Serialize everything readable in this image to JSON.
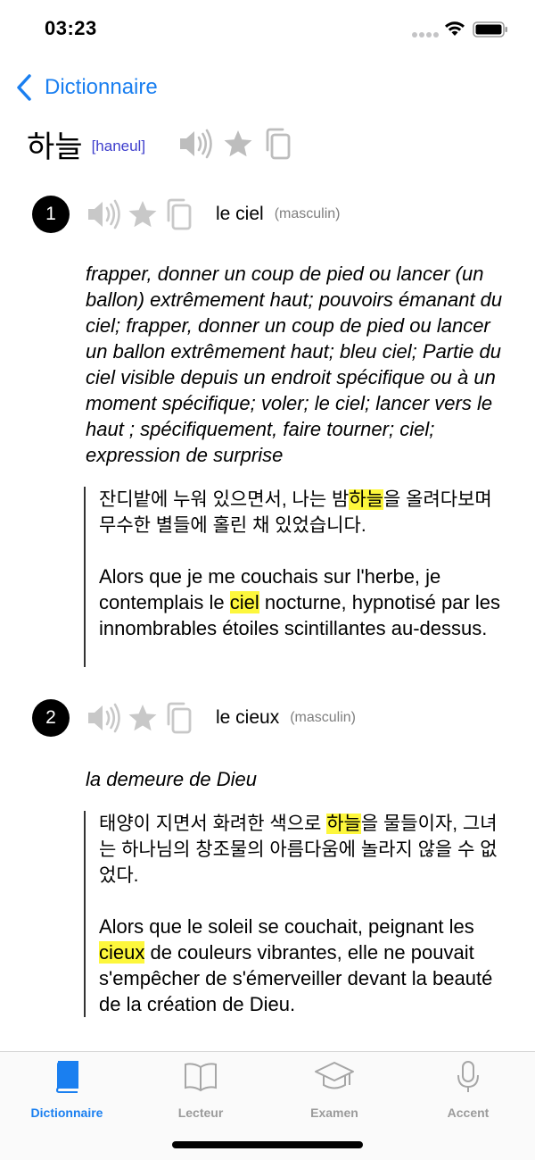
{
  "status": {
    "time": "03:23"
  },
  "nav": {
    "back_label": "Dictionnaire"
  },
  "entry": {
    "headword": "하늘",
    "romanization": "[haneul]"
  },
  "senses": [
    {
      "number": "1",
      "translation": "le ciel",
      "gender": "(masculin)",
      "definition": "frapper, donner un coup de pied ou lancer (un ballon) extrêmement haut; pouvoirs émanant du ciel; frapper, donner un coup de pied ou lancer un ballon extrêmement haut; bleu ciel; Partie du ciel visible depuis un endroit spécifique ou à un moment spécifique; voler; le ciel; lancer vers le haut ; spécifiquement, faire tourner; ciel; expression de surprise",
      "example_ko": {
        "before": "잔디밭에 누워 있으면서, 나는 밤",
        "highlight": "하늘",
        "after": "을 올려다보며 무수한 별들에 홀린 채 있었습니다."
      },
      "example_fr": {
        "before": "Alors que je me couchais sur l'herbe, je contemplais le ",
        "highlight": "ciel",
        "after": " nocturne, hypnotisé par les innombrables étoiles scintillantes au-dessus."
      }
    },
    {
      "number": "2",
      "translation": "le cieux",
      "gender": "(masculin)",
      "definition": "la demeure de Dieu",
      "example_ko": {
        "before": "태양이 지면서 화려한 색으로 ",
        "highlight": "하늘",
        "after": "을 물들이자, 그녀는 하나님의 창조물의 아름다움에 놀라지 않을 수 없었다."
      },
      "example_fr": {
        "before": "Alors que le soleil se couchait, peignant les ",
        "highlight": "cieux",
        "after": " de couleurs vibrantes, elle ne pouvait s'empêcher de s'émerveiller devant la beauté de la création de Dieu."
      }
    }
  ],
  "tabs": [
    {
      "label": "Dictionnaire",
      "icon": "book-icon",
      "active": true
    },
    {
      "label": "Lecteur",
      "icon": "open-book-icon",
      "active": false
    },
    {
      "label": "Examen",
      "icon": "graduation-cap-icon",
      "active": false
    },
    {
      "label": "Accent",
      "icon": "microphone-icon",
      "active": false
    }
  ],
  "colors": {
    "accent": "#1a7ff0",
    "highlight": "#fdf73c",
    "romanization": "#3d3dcc",
    "icon_gray": "#bdbdbd"
  }
}
